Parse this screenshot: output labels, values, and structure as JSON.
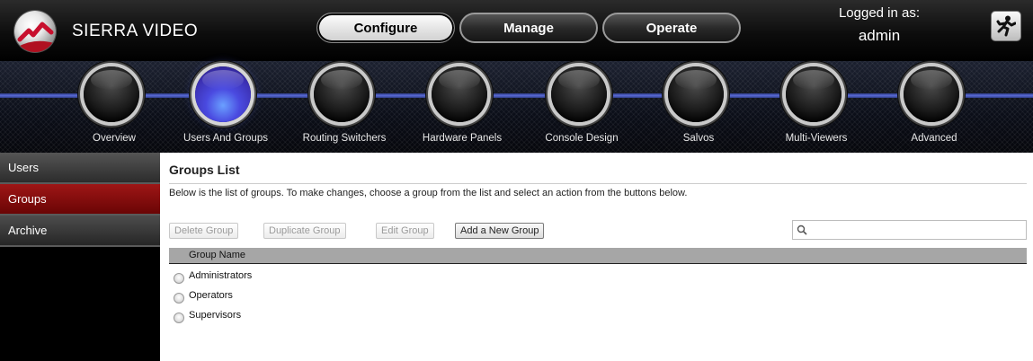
{
  "header": {
    "brand": "SIERRA VIDEO",
    "modes": [
      "Configure",
      "Manage",
      "Operate"
    ],
    "active_mode": "Configure",
    "logged_in_label": "Logged in as:",
    "username": "admin",
    "logout_icon": "running-man-exit-icon"
  },
  "nav": {
    "items": [
      {
        "label": "Overview"
      },
      {
        "label": "Users And Groups"
      },
      {
        "label": "Routing Switchers"
      },
      {
        "label": "Hardware Panels"
      },
      {
        "label": "Console Design"
      },
      {
        "label": "Salvos"
      },
      {
        "label": "Multi-Viewers"
      },
      {
        "label": "Advanced"
      }
    ],
    "active": "Users And Groups"
  },
  "sidebar": {
    "items": [
      {
        "label": "Users"
      },
      {
        "label": "Groups"
      },
      {
        "label": "Archive"
      }
    ],
    "active": "Groups"
  },
  "main": {
    "title": "Groups List",
    "description": "Below is the list of groups. To make changes, choose a group from the list and select an action from the buttons below.",
    "buttons": {
      "delete": "Delete Group",
      "duplicate": "Duplicate Group",
      "edit": "Edit Group",
      "add": "Add a New Group"
    },
    "search": {
      "placeholder": "",
      "value": ""
    },
    "table": {
      "columns": [
        "Group Name"
      ],
      "rows": [
        "Administrators",
        "Operators",
        "Supervisors"
      ]
    }
  },
  "colors": {
    "accent_red": "#8b0a0a",
    "nav_line_blue": "#4a5bc8",
    "active_orb": "#4a4ae0"
  }
}
